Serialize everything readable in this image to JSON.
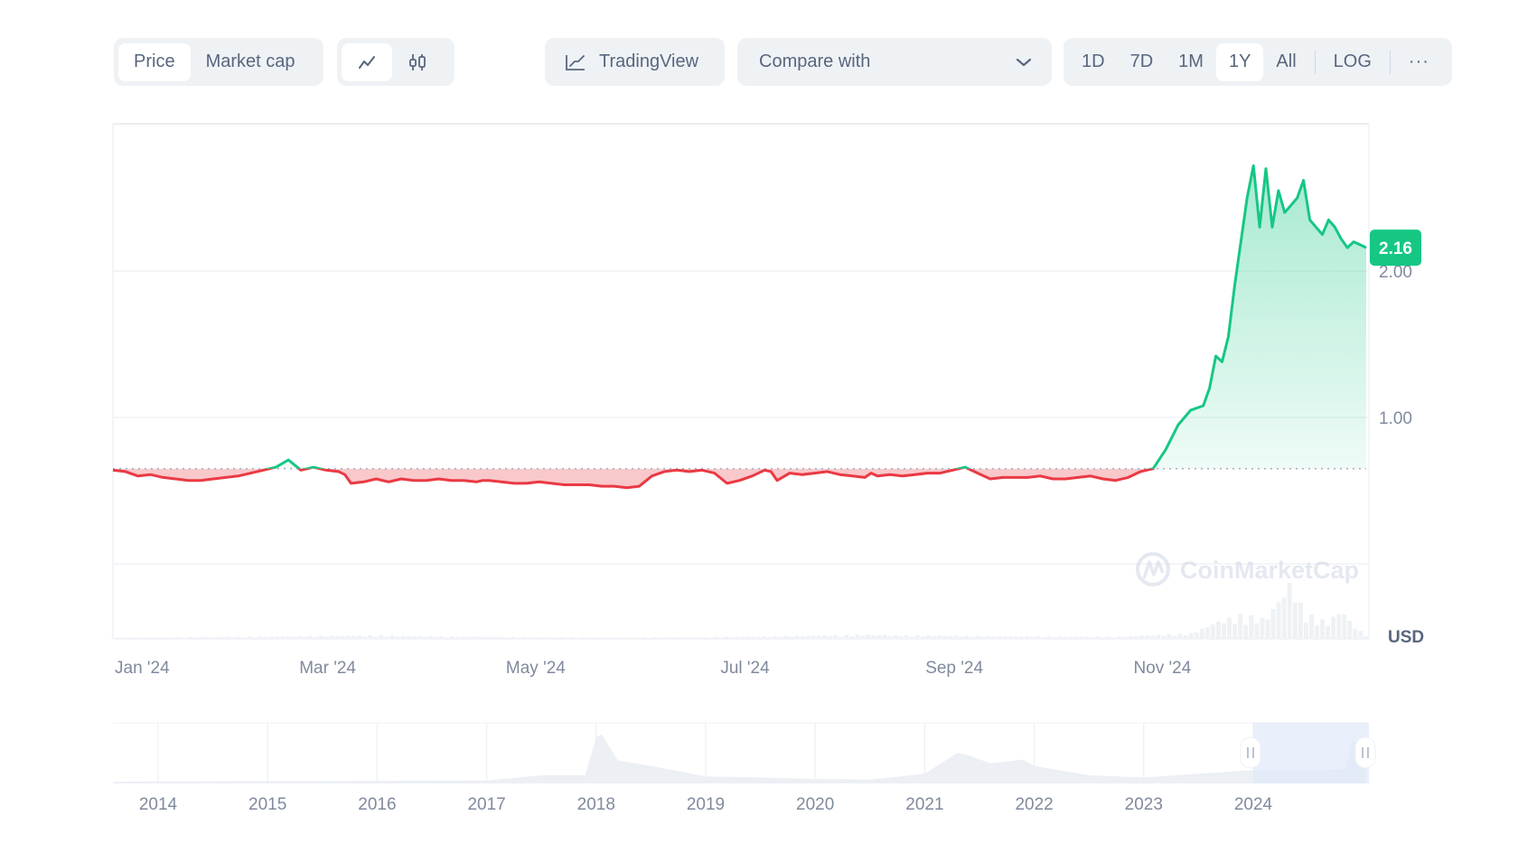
{
  "toolbar": {
    "metric_tabs": [
      {
        "label": "Price",
        "active": true
      },
      {
        "label": "Market cap",
        "active": false
      }
    ],
    "chart_type_tabs": [
      {
        "icon": "line-chart-icon",
        "active": true
      },
      {
        "icon": "candlestick-icon",
        "active": false
      }
    ],
    "tradingview_label": "TradingView",
    "compare_label": "Compare with",
    "range_tabs": [
      {
        "label": "1D",
        "active": false
      },
      {
        "label": "7D",
        "active": false
      },
      {
        "label": "1M",
        "active": false
      },
      {
        "label": "1Y",
        "active": true
      },
      {
        "label": "All",
        "active": false
      }
    ],
    "log_label": "LOG",
    "more_label": "···"
  },
  "colors": {
    "up": "#16c784",
    "down": "#ea3943",
    "grid": "#eff2f5",
    "text": "#808a9d",
    "price_badge": "#16c784",
    "navigator_selection": "#e8eefc"
  },
  "watermark": "CoinMarketCap",
  "currency_label": "USD",
  "chart_data": {
    "type": "area",
    "title": "",
    "xlabel": "",
    "ylabel": "USD",
    "current_price": 2.16,
    "current_price_label": "2.16",
    "baseline": 0.65,
    "ylim": [
      0,
      2.85
    ],
    "y_ticks": [
      {
        "value": 1.0,
        "label": "1.00"
      },
      {
        "value": 2.0,
        "label": "2.00"
      }
    ],
    "x_range": [
      "2024-01-01",
      "2024-12-31"
    ],
    "x_ticks": [
      {
        "label": "Jan '24",
        "pos": 0.0
      },
      {
        "label": "Mar '24",
        "pos": 0.167
      },
      {
        "label": "May '24",
        "pos": 0.333
      },
      {
        "label": "Jul '24",
        "pos": 0.5
      },
      {
        "label": "Sep '24",
        "pos": 0.667
      },
      {
        "label": "Nov '24",
        "pos": 0.833
      }
    ],
    "series": [
      {
        "name": "Price",
        "x": [
          0,
          0.01,
          0.02,
          0.03,
          0.04,
          0.05,
          0.06,
          0.07,
          0.08,
          0.09,
          0.1,
          0.11,
          0.12,
          0.13,
          0.14,
          0.15,
          0.16,
          0.17,
          0.18,
          0.185,
          0.19,
          0.2,
          0.21,
          0.22,
          0.23,
          0.24,
          0.25,
          0.26,
          0.27,
          0.28,
          0.29,
          0.295,
          0.3,
          0.31,
          0.32,
          0.33,
          0.34,
          0.35,
          0.36,
          0.37,
          0.38,
          0.39,
          0.4,
          0.41,
          0.42,
          0.43,
          0.44,
          0.45,
          0.46,
          0.47,
          0.48,
          0.49,
          0.5,
          0.51,
          0.52,
          0.525,
          0.53,
          0.54,
          0.55,
          0.56,
          0.57,
          0.58,
          0.59,
          0.6,
          0.605,
          0.61,
          0.62,
          0.63,
          0.64,
          0.65,
          0.66,
          0.67,
          0.68,
          0.69,
          0.7,
          0.71,
          0.72,
          0.73,
          0.74,
          0.75,
          0.76,
          0.77,
          0.78,
          0.79,
          0.8,
          0.81,
          0.82,
          0.83,
          0.84,
          0.85,
          0.86,
          0.87,
          0.875,
          0.88,
          0.885,
          0.89,
          0.895,
          0.9,
          0.905,
          0.91,
          0.915,
          0.92,
          0.925,
          0.93,
          0.935,
          0.94,
          0.945,
          0.95,
          0.955,
          0.96,
          0.965,
          0.97,
          0.975,
          0.98,
          0.985,
          0.99,
          0.995,
          1.0
        ],
        "y": [
          0.64,
          0.63,
          0.6,
          0.61,
          0.59,
          0.58,
          0.57,
          0.57,
          0.58,
          0.59,
          0.6,
          0.62,
          0.64,
          0.66,
          0.71,
          0.64,
          0.66,
          0.64,
          0.63,
          0.61,
          0.55,
          0.56,
          0.58,
          0.56,
          0.58,
          0.57,
          0.57,
          0.58,
          0.57,
          0.57,
          0.56,
          0.57,
          0.57,
          0.56,
          0.55,
          0.55,
          0.56,
          0.55,
          0.54,
          0.54,
          0.54,
          0.53,
          0.53,
          0.52,
          0.53,
          0.6,
          0.63,
          0.64,
          0.63,
          0.64,
          0.62,
          0.55,
          0.57,
          0.6,
          0.64,
          0.63,
          0.57,
          0.62,
          0.61,
          0.62,
          0.63,
          0.61,
          0.6,
          0.59,
          0.62,
          0.6,
          0.61,
          0.6,
          0.61,
          0.62,
          0.62,
          0.64,
          0.66,
          0.62,
          0.58,
          0.59,
          0.59,
          0.59,
          0.6,
          0.58,
          0.58,
          0.59,
          0.6,
          0.58,
          0.57,
          0.59,
          0.63,
          0.65,
          0.78,
          0.95,
          1.05,
          1.08,
          1.2,
          1.42,
          1.38,
          1.55,
          1.9,
          2.2,
          2.5,
          2.72,
          2.3,
          2.7,
          2.3,
          2.55,
          2.4,
          2.45,
          2.5,
          2.62,
          2.35,
          2.3,
          2.25,
          2.35,
          2.3,
          2.22,
          2.16,
          2.2,
          2.18,
          2.16
        ]
      }
    ],
    "volume_series": {
      "name": "Volume",
      "note": "relative volume bars, highest in Dec '24",
      "x": [
        0.0,
        0.1,
        0.2,
        0.3,
        0.4,
        0.5,
        0.6,
        0.7,
        0.8,
        0.86,
        0.88,
        0.9,
        0.92,
        0.94,
        0.95,
        0.96,
        0.97,
        0.98,
        0.99,
        1.0
      ],
      "y": [
        0.02,
        0.03,
        0.05,
        0.03,
        0.02,
        0.03,
        0.06,
        0.04,
        0.03,
        0.08,
        0.25,
        0.35,
        0.3,
        0.85,
        0.4,
        0.3,
        0.25,
        0.45,
        0.2,
        0.05
      ]
    },
    "navigator": {
      "type": "area",
      "x_ticks": [
        "2014",
        "2015",
        "2016",
        "2017",
        "2018",
        "2019",
        "2020",
        "2021",
        "2022",
        "2023",
        "2024"
      ],
      "selection": {
        "from": "2024-01",
        "to": "2024-12"
      },
      "x": [
        2013.6,
        2017.0,
        2017.5,
        2017.9,
        2018.0,
        2018.05,
        2018.2,
        2018.5,
        2019.0,
        2019.5,
        2020.0,
        2020.5,
        2021.0,
        2021.3,
        2021.4,
        2021.6,
        2021.9,
        2022.0,
        2022.5,
        2023.0,
        2023.5,
        2024.0,
        2024.5,
        2024.85,
        2024.9,
        2025.0
      ],
      "y": [
        0.0,
        0.02,
        0.12,
        0.12,
        0.85,
        0.9,
        0.4,
        0.3,
        0.1,
        0.08,
        0.05,
        0.04,
        0.15,
        0.55,
        0.5,
        0.35,
        0.42,
        0.3,
        0.12,
        0.08,
        0.15,
        0.22,
        0.2,
        0.25,
        0.8,
        0.7
      ]
    }
  }
}
